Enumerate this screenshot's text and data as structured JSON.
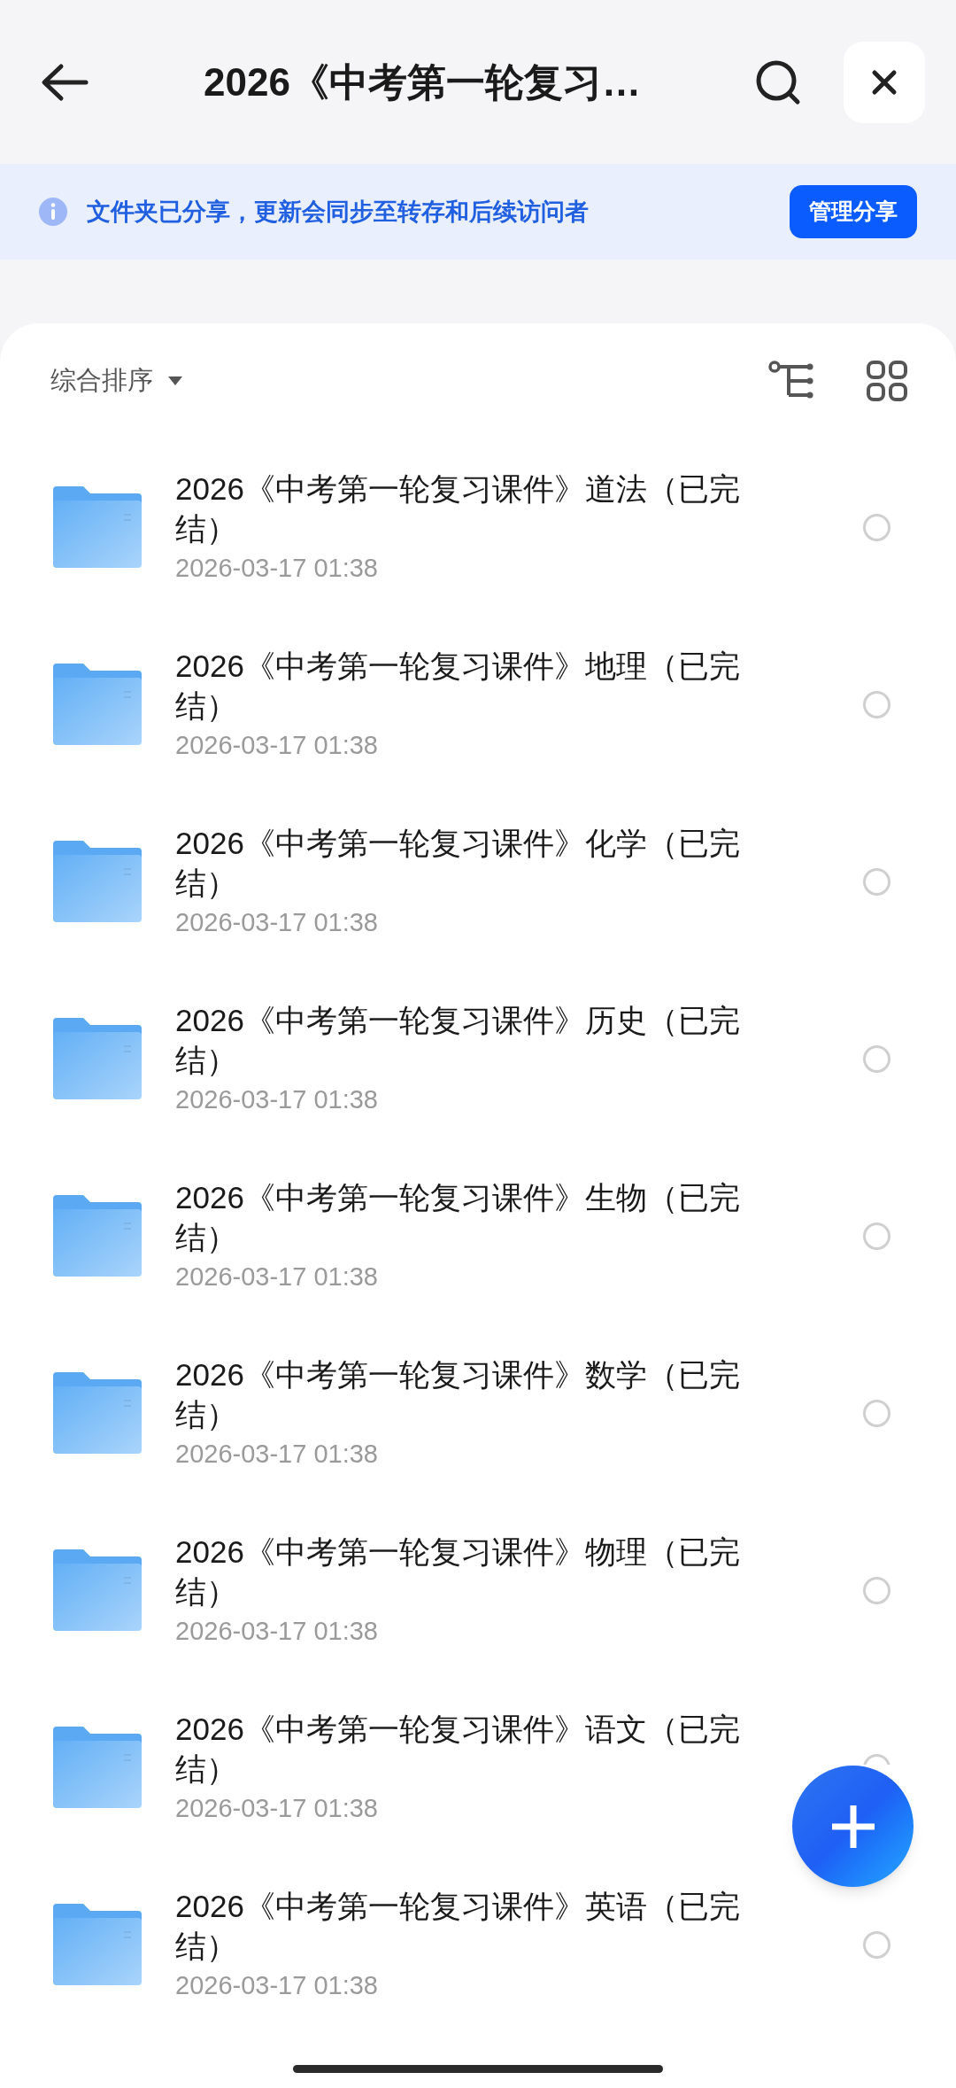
{
  "header": {
    "title": "2026《中考第一轮复习…"
  },
  "share_banner": {
    "message": "文件夹已分享，更新会同步至转存和后续访问者",
    "button": "管理分享"
  },
  "sort": {
    "label": "综合排序"
  },
  "files": [
    {
      "name": "2026《中考第一轮复习课件》道法（已完结）",
      "date": "2026-03-17 01:38",
      "selected": false
    },
    {
      "name": "2026《中考第一轮复习课件》地理（已完结）",
      "date": "2026-03-17 01:38",
      "selected": false
    },
    {
      "name": "2026《中考第一轮复习课件》化学（已完结）",
      "date": "2026-03-17 01:38",
      "selected": false
    },
    {
      "name": "2026《中考第一轮复习课件》历史（已完结）",
      "date": "2026-03-17 01:38",
      "selected": false
    },
    {
      "name": "2026《中考第一轮复习课件》生物（已完结）",
      "date": "2026-03-17 01:38",
      "selected": false
    },
    {
      "name": "2026《中考第一轮复习课件》数学（已完结）",
      "date": "2026-03-17 01:38",
      "selected": false
    },
    {
      "name": "2026《中考第一轮复习课件》物理（已完结）",
      "date": "2026-03-17 01:38",
      "selected": false
    },
    {
      "name": "2026《中考第一轮复习课件》语文（已完结）",
      "date": "2026-03-17 01:38",
      "selected": false
    },
    {
      "name": "2026《中考第一轮复习课件》英语（已完结）",
      "date": "2026-03-17 01:38",
      "selected": false
    }
  ]
}
